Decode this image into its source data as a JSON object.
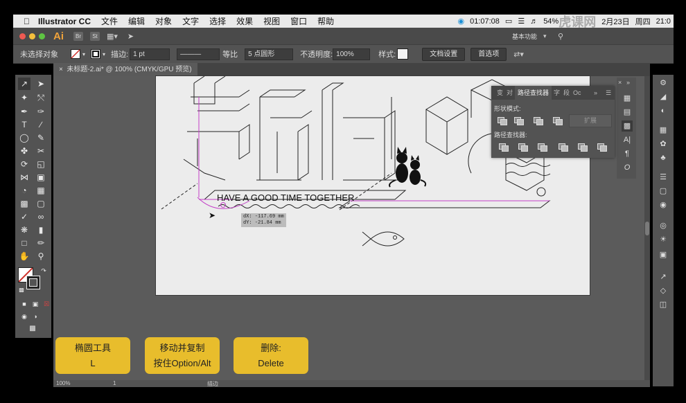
{
  "menubar": {
    "app_name": "Illustrator CC",
    "items": [
      "文件",
      "编辑",
      "对象",
      "文字",
      "选择",
      "效果",
      "视图",
      "窗口",
      "帮助"
    ],
    "record_time": "01:07:08",
    "battery": "54%",
    "date": "2月23日",
    "weekday": "周四",
    "clock": "21:0",
    "watermark": "虎课网"
  },
  "appbar": {
    "logo": "Ai",
    "br": "Br",
    "st": "St",
    "workspace": "基本功能"
  },
  "control": {
    "selection": "未选择对象",
    "stroke_label": "描边:",
    "stroke_weight": "1 pt",
    "profile": "等比",
    "brush": "5 点圆形",
    "opacity_label": "不透明度:",
    "opacity": "100%",
    "style_label": "样式:",
    "doc_setup": "文档设置",
    "prefs": "首选项"
  },
  "tab": {
    "title": "未标题-2.ai* @ 100% (CMYK/GPU 预览)"
  },
  "artwork": {
    "tagline": "HAVE A GOOD TIME TOGETHER",
    "dx": "dX: -117.69 mm",
    "dy": "dY: -21.84 mm"
  },
  "pathfinder": {
    "tab_transform": "变",
    "tab_align": "对",
    "tab_pathfinder": "路径查找器",
    "tab_char": "字",
    "tab_para": "段",
    "tab_opentype": "Oc",
    "shape_modes": "形状模式:",
    "expand": "扩展",
    "pathfinders": "路径查找器:"
  },
  "captions": [
    {
      "line1": "椭圆工具",
      "line2": "L"
    },
    {
      "line1": "移动并复制",
      "line2": "按住Option/Alt"
    },
    {
      "line1": "删除:",
      "line2": "Delete"
    }
  ],
  "status": {
    "zoom": "100%",
    "page": "1",
    "mode": "描边"
  },
  "colors": {
    "caption_bg": "#e8bd2c",
    "ui_dark": "#535353",
    "artboard": "#ececec",
    "ai_orange": "#f0a33a"
  }
}
